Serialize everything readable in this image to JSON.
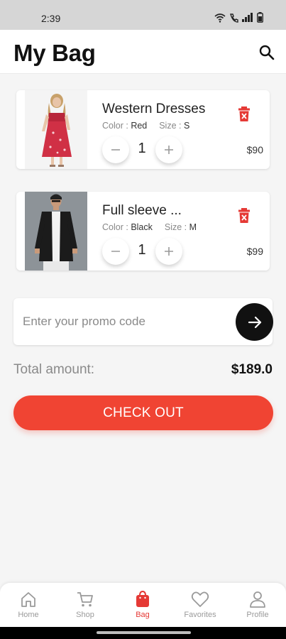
{
  "status_bar": {
    "time": "2:39"
  },
  "header": {
    "title": "My Bag",
    "search_icon": "search-icon"
  },
  "cart": {
    "items": [
      {
        "name": "Western Dresses",
        "color_label": "Color :",
        "color": "Red",
        "size_label": "Size :",
        "size": "S",
        "quantity": "1",
        "price": "$90"
      },
      {
        "name": "Full sleeve ...",
        "color_label": "Color :",
        "color": "Black",
        "size_label": "Size :",
        "size": "M",
        "quantity": "1",
        "price": "$99"
      }
    ]
  },
  "promo": {
    "placeholder": "Enter your promo code"
  },
  "summary": {
    "total_label": "Total amount:",
    "total_value": "$189.0"
  },
  "checkout": {
    "label": "CHECK OUT"
  },
  "bottom_nav": {
    "items": [
      {
        "label": "Home",
        "icon": "home-icon"
      },
      {
        "label": "Shop",
        "icon": "cart-icon"
      },
      {
        "label": "Bag",
        "icon": "bag-icon",
        "active": true
      },
      {
        "label": "Favorites",
        "icon": "heart-icon"
      },
      {
        "label": "Profile",
        "icon": "profile-icon"
      }
    ]
  },
  "colors": {
    "accent": "#f04433",
    "active_nav": "#e53935",
    "delete": "#e53935"
  }
}
